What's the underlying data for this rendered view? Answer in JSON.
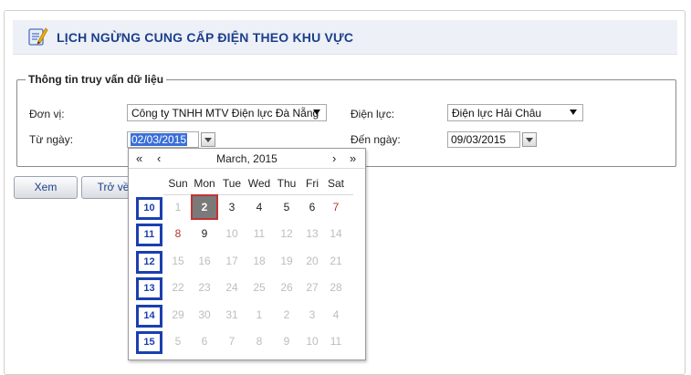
{
  "header": {
    "title": "LỊCH NGỪNG CUNG CẤP ĐIỆN THEO KHU VỰC",
    "icon": "notepad-pencil-icon"
  },
  "query": {
    "legend": "Thông tin truy vấn dữ liệu",
    "don_vi_label": "Đơn vị:",
    "don_vi_value": "Công ty TNHH MTV Điện lực Đà Nẵng",
    "dien_luc_label": "Điện lực:",
    "dien_luc_value": "Điện lực Hải Châu",
    "tu_ngay_label": "Từ ngày:",
    "tu_ngay_value": "02/03/2015",
    "den_ngay_label": "Đến ngày:",
    "den_ngay_value": "09/03/2015"
  },
  "buttons": {
    "xem": "Xem",
    "tro_ve": "Trở về"
  },
  "calendar": {
    "nav": {
      "prev_year": "«",
      "prev_month": "‹",
      "next_month": "›",
      "next_year": "»"
    },
    "title": "March, 2015",
    "weekdays": [
      "Sun",
      "Mon",
      "Tue",
      "Wed",
      "Thu",
      "Fri",
      "Sat"
    ],
    "weeks": [
      {
        "week": "10",
        "days": [
          [
            "1",
            "other"
          ],
          [
            "2",
            "today"
          ],
          [
            "3",
            "cur"
          ],
          [
            "4",
            "cur"
          ],
          [
            "5",
            "cur"
          ],
          [
            "6",
            "cur"
          ],
          [
            "7",
            "sun"
          ]
        ]
      },
      {
        "week": "11",
        "days": [
          [
            "8",
            "sun"
          ],
          [
            "9",
            "cur"
          ],
          [
            "10",
            "other"
          ],
          [
            "11",
            "other"
          ],
          [
            "12",
            "other"
          ],
          [
            "13",
            "other"
          ],
          [
            "14",
            "other"
          ]
        ]
      },
      {
        "week": "12",
        "days": [
          [
            "15",
            "other"
          ],
          [
            "16",
            "other"
          ],
          [
            "17",
            "other"
          ],
          [
            "18",
            "other"
          ],
          [
            "19",
            "other"
          ],
          [
            "20",
            "other"
          ],
          [
            "21",
            "other"
          ]
        ]
      },
      {
        "week": "13",
        "days": [
          [
            "22",
            "other"
          ],
          [
            "23",
            "other"
          ],
          [
            "24",
            "other"
          ],
          [
            "25",
            "other"
          ],
          [
            "26",
            "other"
          ],
          [
            "27",
            "other"
          ],
          [
            "28",
            "other"
          ]
        ]
      },
      {
        "week": "14",
        "days": [
          [
            "29",
            "other"
          ],
          [
            "30",
            "other"
          ],
          [
            "31",
            "other"
          ],
          [
            "1",
            "other"
          ],
          [
            "2",
            "other"
          ],
          [
            "3",
            "other"
          ],
          [
            "4",
            "other"
          ]
        ]
      },
      {
        "week": "15",
        "days": [
          [
            "5",
            "other"
          ],
          [
            "6",
            "other"
          ],
          [
            "7",
            "other"
          ],
          [
            "8",
            "other"
          ],
          [
            "9",
            "other"
          ],
          [
            "10",
            "other"
          ],
          [
            "11",
            "other"
          ]
        ]
      }
    ]
  }
}
